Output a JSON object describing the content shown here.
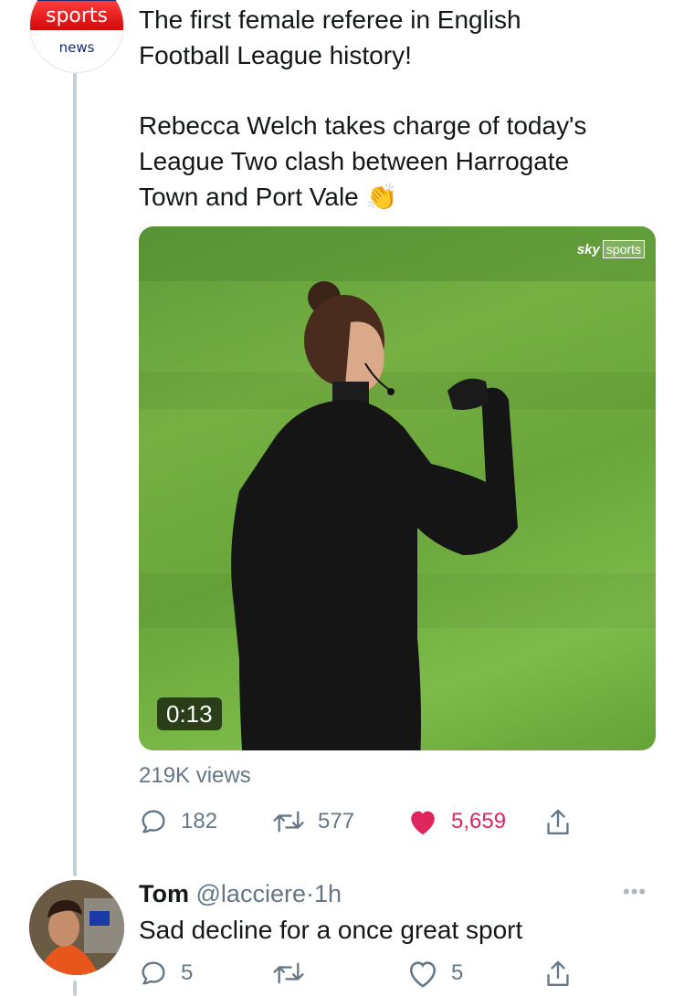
{
  "tweet": {
    "avatar_lines": [
      "sports",
      "news"
    ],
    "text_lines": [
      "The first female referee in English",
      "Football League history!",
      "Rebecca Welch takes charge of today's",
      "League Two clash between Harrogate",
      "Town and Port Vale 👏"
    ],
    "media": {
      "watermark_sky": "sky",
      "watermark_sports": "sports",
      "duration": "0:13"
    },
    "views": "219K views",
    "actions": {
      "replies": "182",
      "retweets": "577",
      "likes": "5,659"
    }
  },
  "reply": {
    "name": "Tom",
    "handle": "@lacciere",
    "separator": "·",
    "time": "1h",
    "text": "Sad decline for a once great sport",
    "actions": {
      "replies": "5",
      "likes": "5"
    }
  },
  "colors": {
    "text": "#14171a",
    "muted": "#657786",
    "like": "#e0245e",
    "thread_line": "#c4cfd6"
  }
}
